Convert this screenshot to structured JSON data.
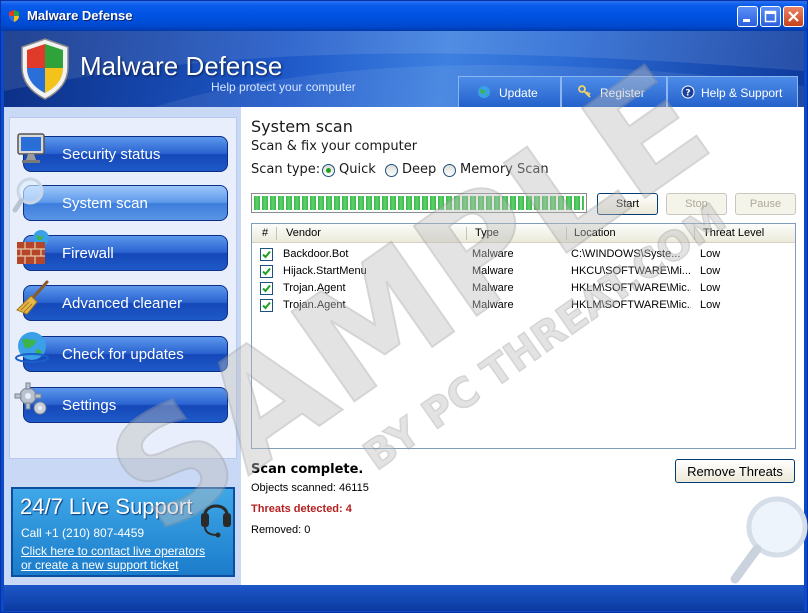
{
  "window": {
    "title": "Malware Defense"
  },
  "header": {
    "app_title": "Malware Defense",
    "tagline": "Help protect your computer"
  },
  "tabs": [
    {
      "label": "Update",
      "icon": "globe-icon"
    },
    {
      "label": "Register",
      "icon": "key-icon"
    },
    {
      "label": "Help & Support",
      "icon": "help-icon"
    }
  ],
  "sidebar": {
    "items": [
      {
        "label": "Security status",
        "icon": "monitor-icon"
      },
      {
        "label": "System scan",
        "icon": "magnifier-icon",
        "active": true
      },
      {
        "label": "Firewall",
        "icon": "brick-wall-icon"
      },
      {
        "label": "Advanced cleaner",
        "icon": "broom-icon"
      },
      {
        "label": "Check for updates",
        "icon": "globe-icon"
      },
      {
        "label": "Settings",
        "icon": "gear-icon"
      }
    ]
  },
  "support": {
    "title": "24/7 Live Support",
    "phone": "Call +1 (210) 807-4459",
    "link1": "Click here to contact live operators",
    "link2": "or create a new support ticket"
  },
  "main": {
    "title": "System scan",
    "subtitle": "Scan & fix your computer",
    "scan_type_label": "Scan type:",
    "scan_options": [
      "Quick",
      "Deep",
      "Memory Scan"
    ],
    "scan_selected": "Quick",
    "progress": 1.0,
    "buttons": {
      "start": "Start",
      "stop": "Stop",
      "pause": "Pause"
    },
    "table": {
      "columns": [
        "#",
        "Vendor",
        "Type",
        "Location",
        "Threat Level"
      ],
      "rows": [
        {
          "vendor": "Backdoor.Bot",
          "type": "Malware",
          "location": "C:\\WINDOWS\\Syste...",
          "level": "Low",
          "checked": true
        },
        {
          "vendor": "Hijack.StartMenu",
          "type": "Malware",
          "location": "HKCU\\SOFTWARE\\Mi...",
          "level": "Low",
          "checked": true
        },
        {
          "vendor": "Trojan.Agent",
          "type": "Malware",
          "location": "HKLM\\SOFTWARE\\Mic...",
          "level": "Low",
          "checked": true
        },
        {
          "vendor": "Trojan.Agent",
          "type": "Malware",
          "location": "HKLM\\SOFTWARE\\Mic...",
          "level": "Low",
          "checked": true
        }
      ]
    },
    "status": {
      "complete": "Scan complete.",
      "objects": "Objects scanned: 46115",
      "threats": "Threats detected: 4",
      "removed": "Removed: 0"
    },
    "remove_button": "Remove Threats"
  },
  "watermark": {
    "line1": "SAMPLE",
    "line2": "BY PC THREAT.COM"
  },
  "colors": {
    "titlebar": "#0054e3",
    "nav_button": "#2a63d0",
    "threats_text": "#b52020",
    "progress_fill": "#39b54a"
  }
}
